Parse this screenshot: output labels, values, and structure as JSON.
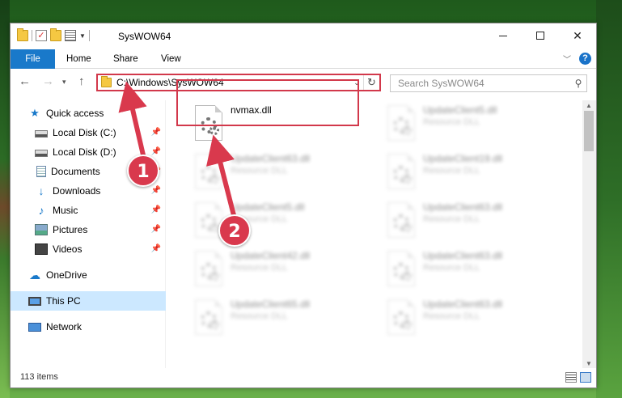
{
  "window": {
    "title": "SysWOW64"
  },
  "ribbon": {
    "tabs": [
      {
        "label": "File"
      },
      {
        "label": "Home"
      },
      {
        "label": "Share"
      },
      {
        "label": "View"
      }
    ]
  },
  "address_bar": {
    "path": "C:\\Windows\\SysWOW64"
  },
  "search": {
    "placeholder": "Search SysWOW64"
  },
  "sidebar": {
    "items": [
      {
        "label": "Quick access",
        "icon": "star-icon"
      },
      {
        "label": "Local Disk (C:)",
        "icon": "disk-icon"
      },
      {
        "label": "Local Disk (D:)",
        "icon": "disk-icon"
      },
      {
        "label": "Documents",
        "icon": "document-icon"
      },
      {
        "label": "Downloads",
        "icon": "download-icon"
      },
      {
        "label": "Music",
        "icon": "music-icon"
      },
      {
        "label": "Pictures",
        "icon": "pictures-icon"
      },
      {
        "label": "Videos",
        "icon": "videos-icon"
      },
      {
        "label": "OneDrive",
        "icon": "cloud-icon"
      },
      {
        "label": "This PC",
        "icon": "computer-icon"
      },
      {
        "label": "Network",
        "icon": "network-icon"
      }
    ]
  },
  "files": [
    {
      "name": "nvmax.dll",
      "type": ""
    },
    {
      "name": "UpdateClient5.dll",
      "type": "Resource DLL"
    },
    {
      "name": "UpdateClient63.dll",
      "type": "Resource DLL"
    },
    {
      "name": "UpdateClient19.dll",
      "type": "Resource DLL"
    },
    {
      "name": "UpdateClient5.dll",
      "type": "Resource DLL"
    },
    {
      "name": "UpdateClient63.dll",
      "type": "Resource DLL"
    },
    {
      "name": "UpdateClient42.dll",
      "type": "Resource DLL"
    },
    {
      "name": "UpdateClient63.dll",
      "type": "Resource DLL"
    },
    {
      "name": "UpdateClient65.dll",
      "type": "Resource DLL"
    },
    {
      "name": "UpdateClient63.dll",
      "type": "Resource DLL"
    }
  ],
  "status": {
    "item_count": "113 items"
  },
  "annotations": {
    "step1": "1",
    "step2": "2",
    "color": "#d9394d"
  }
}
